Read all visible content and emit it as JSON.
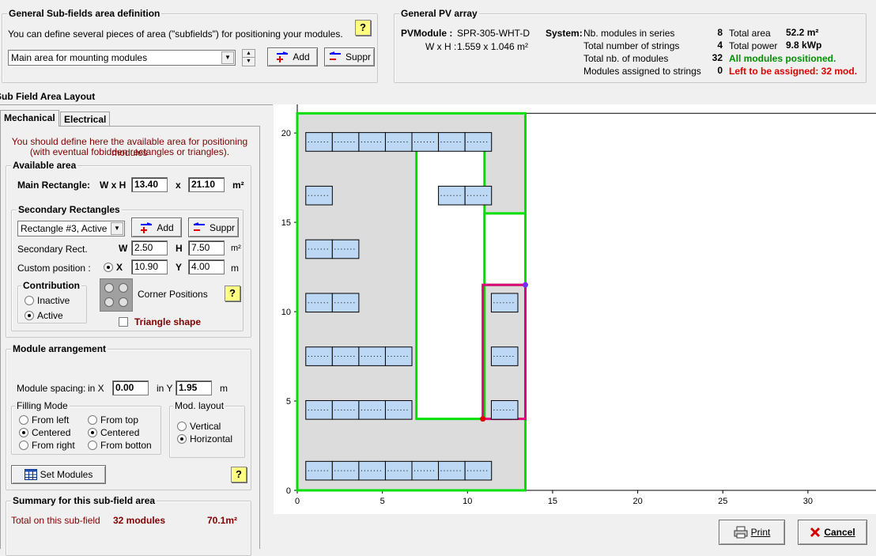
{
  "general_subfields": {
    "title": "General Sub-fields area definition",
    "description": "You can define several pieces of area (\"subfields\")  for positioning your modules.",
    "selected_area": "Main area for mounting modules",
    "add_label": "Add",
    "suppr_label": "Suppr",
    "help_label": "?"
  },
  "pv_array": {
    "title": "General PV array",
    "pvmodule_label": "PVModule :",
    "pvmodule_value": "SPR-305-WHT-D",
    "wxh_label": "W x H :",
    "wxh_value": "1.559 x 1.046 m²",
    "system_label": "System:",
    "rows": [
      {
        "label": "Nb. modules in series",
        "value": "8",
        "right_label": "Total area",
        "right_value": "52.2 m²"
      },
      {
        "label": "Total number of strings",
        "value": "4",
        "right_label": "Total power",
        "right_value": "9.8 kWp"
      },
      {
        "label": "Total nb. of modules",
        "value": "32",
        "status": "All modules positioned."
      },
      {
        "label": "Modules assigned to strings",
        "value": "0",
        "status": "Left to be assigned: 32 mod."
      }
    ]
  },
  "layout_title": "Sub Field  Area  Layout",
  "tabs": [
    "Mechanical",
    "Electrical"
  ],
  "mechanical": {
    "hint_line1": "You should define here the available area for positioning modules",
    "hint_line2": "(with eventual fobidden rectangles or triangles).",
    "available_area": {
      "title": "Available area",
      "main_rect_label": "Main Rectangle:",
      "wxh_label": "W x H",
      "w_value": "13.40",
      "x_label": "x",
      "h_value": "21.10",
      "unit": "m²"
    },
    "secondary": {
      "title": "Secondary Rectangles",
      "selected": "Rectangle #3, Active",
      "add_label": "Add",
      "suppr_label": "Suppr",
      "rect_label": "Secondary Rect.",
      "w_label": "W",
      "w_value": "2.50",
      "h_label": "H",
      "h_value": "7.50",
      "rect_unit": "m²",
      "custom_label": "Custom position :",
      "x_label": "X",
      "x_value": "10.90",
      "y_label": "Y",
      "y_value": "4.00",
      "pos_unit": "m",
      "contribution_title": "Contribution",
      "inactive_label": "Inactive",
      "active_label": "Active",
      "corner_label": "Corner Positions",
      "triangle_label": "Triangle shape",
      "help_label": "?"
    },
    "module_arrangement": {
      "title": "Module arrangement",
      "spacing_label": "Module spacing:",
      "in_x_label": "in X",
      "x_value": "0.00",
      "in_y_label": "in Y",
      "y_value": "1.95",
      "unit": "m",
      "filling_title": "Filling Mode",
      "fill_options_left": [
        "From left",
        "Centered",
        "From right"
      ],
      "fill_options_right": [
        "From top",
        "Centered",
        "From botton"
      ],
      "layout_title": "Mod. layout",
      "layout_options": [
        "Vertical",
        "Horizontal"
      ],
      "set_modules_label": "Set Modules",
      "help_label": "?"
    },
    "summary": {
      "title": "Summary for this sub-field area",
      "total_label": "Total on this sub-field",
      "modules": "32 modules",
      "area": "70.1m²"
    }
  },
  "chart_data": {
    "type": "scatter",
    "xlim": [
      0,
      34
    ],
    "ylim": [
      0,
      21.6
    ],
    "x_ticks": [
      0,
      5,
      10,
      15,
      20,
      25,
      30
    ],
    "y_ticks": [
      0,
      5,
      10,
      15,
      20
    ],
    "main_rect": {
      "x": 0,
      "y": 0,
      "w": 13.4,
      "h": 21.1
    },
    "forbidden_rects": [
      {
        "x": 7.0,
        "y": 4.0,
        "w": 4.0,
        "h": 15.5
      },
      {
        "x": 11.0,
        "y": 11.5,
        "w": 2.4,
        "h": 4.0
      }
    ],
    "selected_rect": {
      "x": 10.9,
      "y": 4.0,
      "w": 2.5,
      "h": 7.5
    },
    "module_w": 1.559,
    "module_h": 1.046,
    "module_rows": [
      {
        "y": 1.1,
        "xs": [
          0.5,
          2.059,
          3.618,
          5.177,
          6.736,
          8.295,
          9.854
        ]
      },
      {
        "y": 4.5,
        "xs": [
          0.5,
          2.059,
          3.618,
          5.177,
          11.4
        ]
      },
      {
        "y": 7.5,
        "xs": [
          0.5,
          2.059,
          3.618,
          5.177,
          11.4
        ]
      },
      {
        "y": 10.5,
        "xs": [
          0.5,
          2.059,
          11.4
        ]
      },
      {
        "y": 13.5,
        "xs": [
          0.5,
          2.059
        ]
      },
      {
        "y": 16.5,
        "xs": [
          0.5,
          8.295,
          9.854
        ]
      },
      {
        "y": 19.5,
        "xs": [
          0.5,
          2.059,
          3.618,
          5.177,
          6.736,
          8.295,
          9.854
        ]
      }
    ]
  },
  "colors": {
    "main_border": "#00e000",
    "selected_border": "#e0007a",
    "module_fill": "#bcd8f4",
    "area_fill": "#dcdcdc"
  },
  "bottom": {
    "print_label": "Print",
    "cancel_label": "Cancel"
  }
}
